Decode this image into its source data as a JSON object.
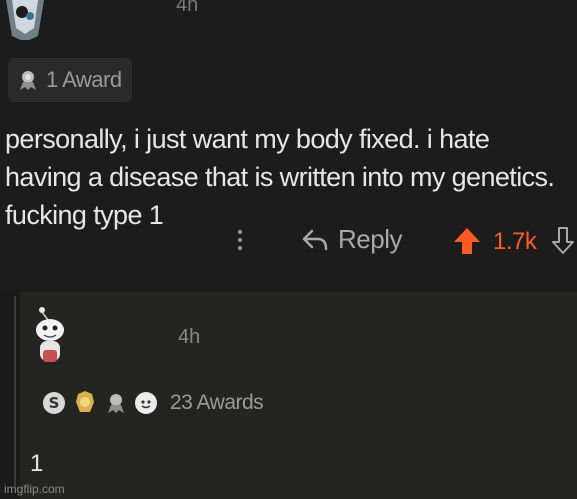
{
  "comment": {
    "timestamp": "4h",
    "award_label": "1 Award",
    "body": "personally, i just want my body fixed. i hate having a disease that is written into my genetics. fucking type 1",
    "reply_label": "Reply",
    "score": "1.7k",
    "icons": [
      "kebab-menu-icon",
      "reply-arrow-icon",
      "upvote-arrow-icon",
      "downvote-arrow-icon"
    ]
  },
  "reply": {
    "timestamp": "4h",
    "awards_label": "23 Awards",
    "body": "1"
  },
  "watermark": "imgflip.com",
  "colors": {
    "background": "#1b1b1b",
    "upvote": "#ff5a1f",
    "reply_background": "#242522"
  }
}
